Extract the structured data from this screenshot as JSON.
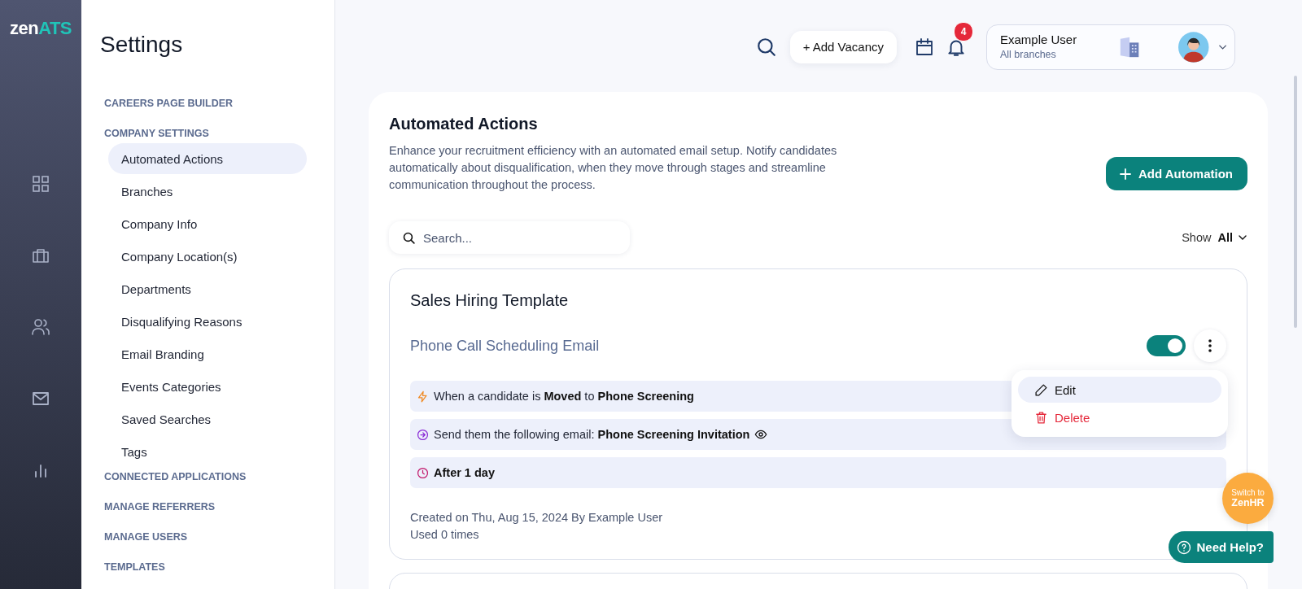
{
  "brand": {
    "prefix": "zen",
    "suffix": "ATS"
  },
  "rail": [
    {
      "kind": "grid"
    },
    {
      "kind": "briefcase"
    },
    {
      "kind": "users"
    },
    {
      "kind": "mail"
    },
    {
      "kind": "chart"
    }
  ],
  "settings": {
    "title": "Settings",
    "sections": [
      {
        "label": "CAREERS PAGE BUILDER"
      },
      {
        "label": "COMPANY SETTINGS",
        "children": [
          {
            "label": "Automated Actions",
            "selected": true
          },
          {
            "label": "Branches",
            "selected": false
          },
          {
            "label": "Company Info",
            "selected": false
          },
          {
            "label": "Company Location(s)",
            "selected": false
          },
          {
            "label": "Departments",
            "selected": false
          },
          {
            "label": "Disqualifying Reasons",
            "selected": false
          },
          {
            "label": "Email Branding",
            "selected": false
          },
          {
            "label": "Events Categories",
            "selected": false
          },
          {
            "label": "Saved Searches",
            "selected": false
          },
          {
            "label": "Tags",
            "selected": false
          }
        ]
      },
      {
        "label": "CONNECTED APPLICATIONS"
      },
      {
        "label": "MANAGE REFERRERS"
      },
      {
        "label": "MANAGE USERS"
      },
      {
        "label": "TEMPLATES"
      }
    ]
  },
  "topbar": {
    "add_vacancy": "+ Add Vacancy",
    "notifications": "4",
    "user": {
      "name": "Example User",
      "branch": "All branches"
    }
  },
  "page": {
    "title": "Automated Actions",
    "description": "Enhance your recruitment efficiency with an automated email setup. Notify candidates automatically about disqualification, when they move through stages and streamline communication throughout the process.",
    "add_button": "Add Automation",
    "search": {
      "placeholder": "Search..."
    },
    "filter": {
      "label": "Show",
      "value": "All"
    },
    "templates": [
      {
        "title": "Sales Hiring Template",
        "automation": {
          "name": "Phone Call Scheduling Email",
          "on": true,
          "steps": [
            {
              "kind": "trigger",
              "text": "When a candidate is **Moved** to **Phone Screening**"
            },
            {
              "kind": "email",
              "text": "Send them the following email: **Phone Screening Invitation**"
            },
            {
              "kind": "delay",
              "text": "After 1 day"
            }
          ],
          "created": "Created on Thu, Aug 15, 2024 By Example User",
          "used": "Used 0 times",
          "menu": [
            {
              "kind": "edit",
              "label": "Edit",
              "selected": true
            },
            {
              "kind": "delete",
              "label": "Delete",
              "selected": false
            }
          ]
        }
      }
    ]
  },
  "switch_badge": {
    "line1": "Switch to",
    "line2": "ZenHR"
  },
  "help_button": "Need Help?"
}
